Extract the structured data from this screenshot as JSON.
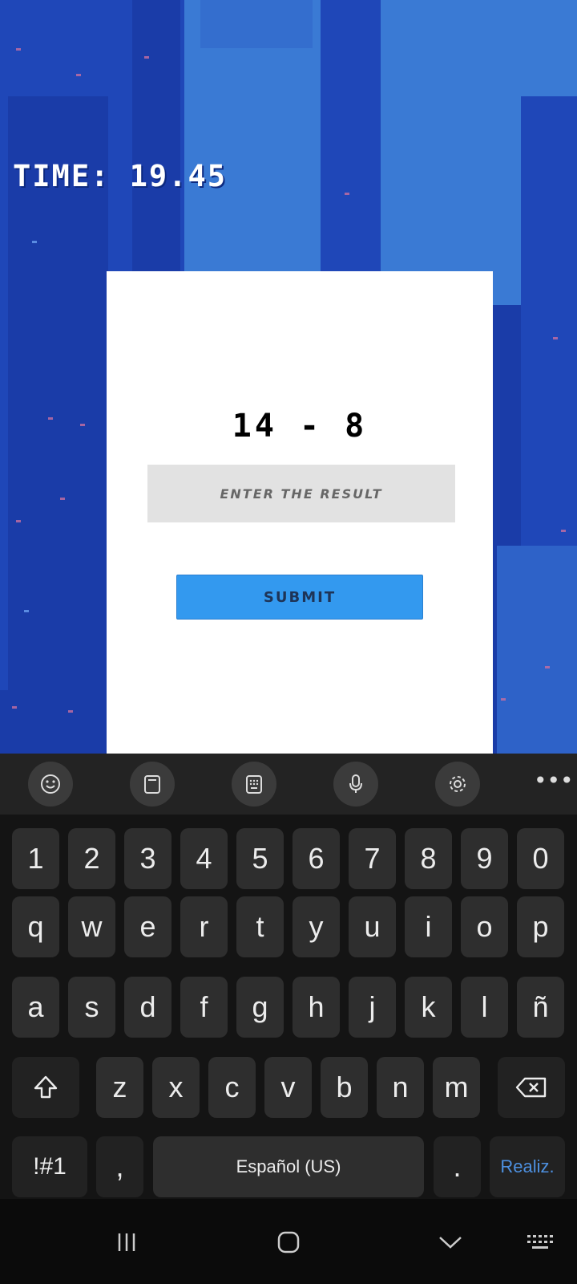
{
  "game": {
    "timer": "TIME: 19.45",
    "equation": "14 - 8",
    "answer_placeholder": "ENTER THE RESULT",
    "submit_label": "SUBMIT"
  },
  "keyboard": {
    "toolbar": [
      "emoji-icon",
      "clipboard-icon",
      "keypad-icon",
      "microphone-icon",
      "settings-icon",
      "more-icon"
    ],
    "more_label": "•••",
    "row_numbers": [
      "1",
      "2",
      "3",
      "4",
      "5",
      "6",
      "7",
      "8",
      "9",
      "0"
    ],
    "row1": [
      "q",
      "w",
      "e",
      "r",
      "t",
      "y",
      "u",
      "i",
      "o",
      "p"
    ],
    "row2": [
      "a",
      "s",
      "d",
      "f",
      "g",
      "h",
      "j",
      "k",
      "l",
      "ñ"
    ],
    "row3": [
      "z",
      "x",
      "c",
      "v",
      "b",
      "n",
      "m"
    ],
    "symbols_label": "!#1",
    "comma_label": ",",
    "space_label": "Español (US)",
    "period_label": ".",
    "done_label": "Realiz.",
    "done_color": "#4d90e0"
  },
  "navbar": [
    "recent-apps-icon",
    "home-icon",
    "back-icon",
    "keyboard-switch-icon"
  ]
}
